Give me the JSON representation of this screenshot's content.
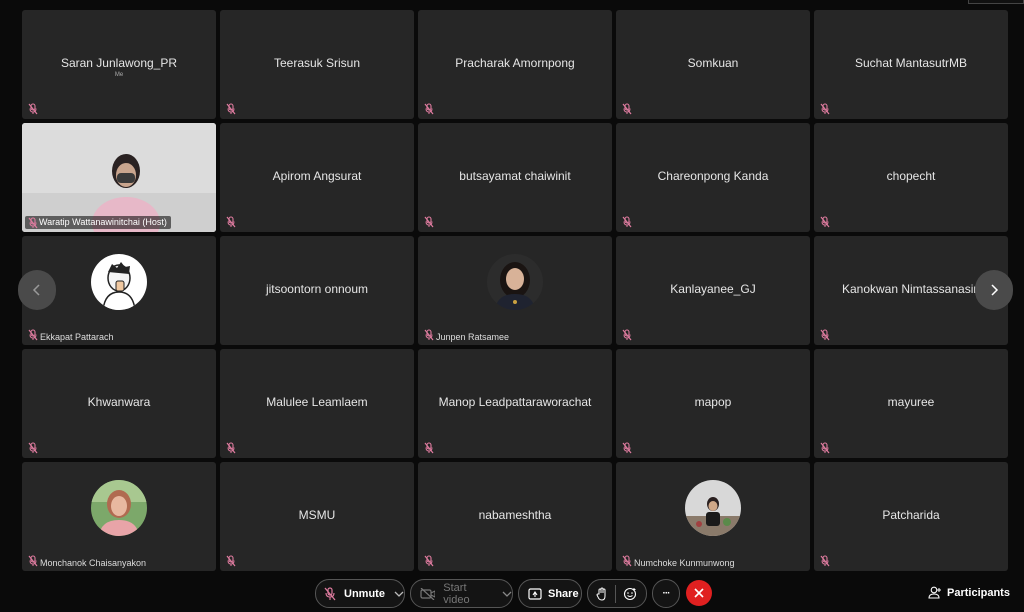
{
  "participants": [
    {
      "name": "Saran Junlawong_PR",
      "subname": "Me"
    },
    {
      "name": "Teerasuk Srisun"
    },
    {
      "name": "Pracharak Amornpong"
    },
    {
      "name": "Somkuan"
    },
    {
      "name": "Suchat MantasutrMB"
    },
    {
      "name": "Waratip Wattanawinitchai (Host)"
    },
    {
      "name": "Apirom Angsurat"
    },
    {
      "name": "butsayamat chaiwinit"
    },
    {
      "name": "Chareonpong Kanda"
    },
    {
      "name": "chopecht"
    },
    {
      "name": "Ekkapat Pattarach"
    },
    {
      "name": "jitsoontorn onnoum"
    },
    {
      "name": "Junpen Ratsamee"
    },
    {
      "name": "Kanlayanee_GJ"
    },
    {
      "name": "Kanokwan Nimtassanasiri"
    },
    {
      "name": "Khwanwara"
    },
    {
      "name": "Malulee Leamlaem"
    },
    {
      "name": "Manop Leadpattaraworachat"
    },
    {
      "name": "mapop"
    },
    {
      "name": "mayuree"
    },
    {
      "name": "Monchanok Chaisanyakon"
    },
    {
      "name": "MSMU"
    },
    {
      "name": "nabameshtha"
    },
    {
      "name": "Numchoke Kunmunwong"
    },
    {
      "name": "Patcharida"
    }
  ],
  "controls": {
    "unmute_label": "Unmute",
    "start_video_label": "Start video",
    "share_label": "Share",
    "more_label": "···",
    "participants_label": "Participants"
  },
  "colors": {
    "tile_bg": "#262626",
    "muted_icon": "#e07ca0",
    "leave_button": "#e02020"
  },
  "icons": {
    "muted_mic": "muted-mic-icon",
    "chevron": "chevron-down-icon",
    "video_off": "video-off-icon",
    "share": "share-screen-icon",
    "raise_hand": "raise-hand-icon",
    "reactions": "reactions-icon",
    "leave": "leave-icon",
    "participants": "participants-icon"
  }
}
